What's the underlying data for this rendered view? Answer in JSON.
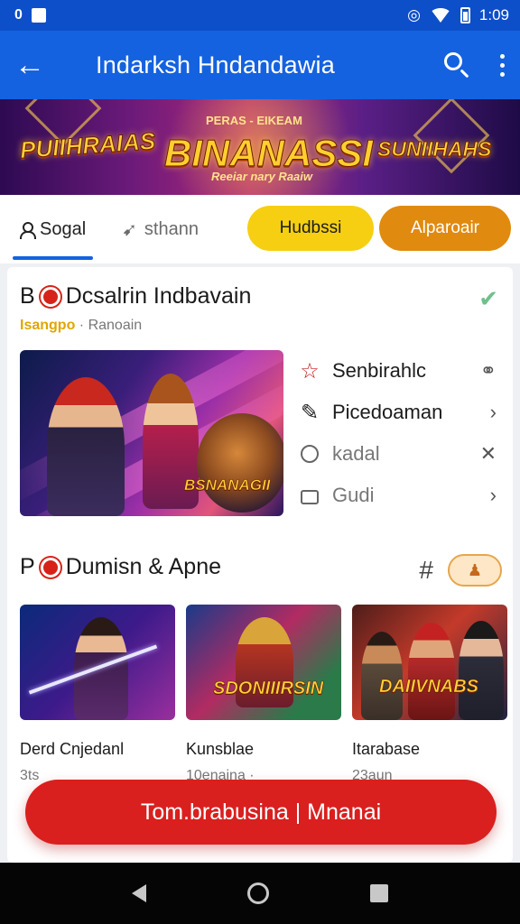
{
  "status_bar": {
    "time": "1:09",
    "left_glyph": "0"
  },
  "app_bar": {
    "title": "Indarksh Hndandawia",
    "back_icon": "arrow-left-icon",
    "search_icon": "search-icon",
    "menu_icon": "more-vertical-icon"
  },
  "banner": {
    "logos": [
      "PUIIHRAIAS",
      "BINANASSI",
      "SUNIIHAHS"
    ],
    "small_top": "PERAS - EIKEAM",
    "small_bottom": "Reeiar nary Raaiw"
  },
  "tabs": [
    {
      "label": "Sogal",
      "icon": "person-icon",
      "active": true
    },
    {
      "label": "sthann",
      "icon": "send-icon",
      "active": false
    }
  ],
  "pills": [
    {
      "label": "Hudbssi",
      "color": "#f6cf12"
    },
    {
      "label": "Alparoair",
      "color": "#e08a10"
    }
  ],
  "section1": {
    "prefix": "B",
    "title": "Dcsalrin Indbavain",
    "sub_highlight": "Isangpo",
    "sub_text": "· Ranoain",
    "check_icon": "check-icon",
    "feature_logo": "BSNANAGII",
    "menu": [
      {
        "label": "Senbirahlc",
        "icon": "star-icon",
        "trail_icon": "link-icon"
      },
      {
        "label": "Picedoaman",
        "icon": "pin-icon",
        "trail_icon": "chevron-right-icon"
      },
      {
        "label": "kadal",
        "icon": "chat-icon",
        "trail_icon": "close-icon"
      },
      {
        "label": "Gudi",
        "icon": "lock-icon",
        "trail_icon": "chevron-right-icon"
      }
    ]
  },
  "section2": {
    "prefix": "P",
    "title": "Dumisn & Apne",
    "hash_icon": "hash-icon",
    "chip_icon": "user-icon",
    "items": [
      {
        "name": "Derd Cnjedanl",
        "meta": "3ts",
        "logo": ""
      },
      {
        "name": "Kunsblae",
        "meta": "10enaina ·",
        "logo": "SDONIIIRSIN"
      },
      {
        "name": "Itarabase",
        "meta": "23aun",
        "logo": "DAIIVNABS"
      }
    ]
  },
  "cta": {
    "label": "Tom.brabusina | Mnanai"
  },
  "colors": {
    "primary": "#1562e0",
    "accent_red": "#d9201f",
    "yellow": "#f6cf12",
    "orange": "#e08a10"
  }
}
